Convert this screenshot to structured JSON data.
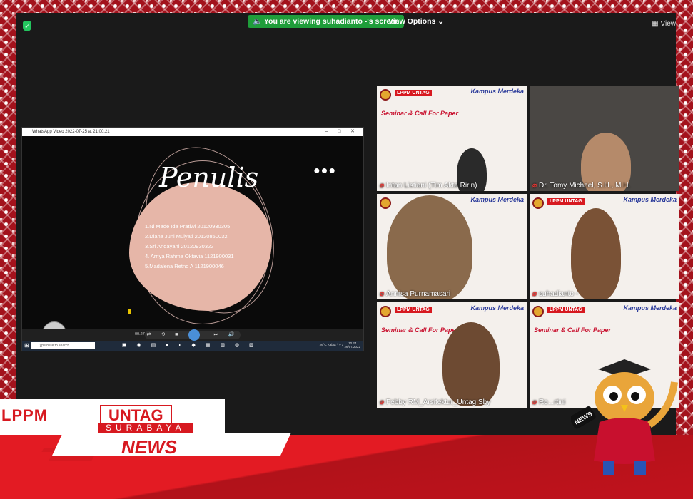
{
  "zoom": {
    "banner_text": "You are viewing suhadianto -'s screen",
    "view_options": "View Options",
    "view_button": "View"
  },
  "shared_window": {
    "title": "WhatsApp Video 2022-07-25 at 21.00.21",
    "slide_title": "Penulis",
    "authors": [
      "1.Ni Made Ida Pratiwi 20120930305",
      "2.Diana Juni Mulyati 20120850032",
      "3.Sri Andayani 20120930322",
      "4.  Arriya Rahma Oktavia 1121900031",
      "5.Madalena Retno A 1121900046"
    ],
    "player_time": "00.27",
    "progress": 0.08,
    "taskbar_search": "Type here to search",
    "tray_weather": "26°C  Kabut",
    "clock_time": "10.24",
    "clock_date": "26/07/2022"
  },
  "participants": [
    {
      "name": "Intan Listiani (Tim Akta Ririn)"
    },
    {
      "name": "Dr. Tomy Michael, S.H., M.H."
    },
    {
      "name": "Annisa Purnamasari"
    },
    {
      "name": "suhadianto -"
    },
    {
      "name": "Febby RM_Arsitektur_Untag Sby"
    },
    {
      "name": "Re...rtini"
    }
  ],
  "tile_branding": {
    "lppm": "LPPM UNTAG",
    "kampus_merdeka": "Kampus Merdeka",
    "seminar": "Seminar & Call For Paper"
  },
  "footer": {
    "lppm": "LPPM",
    "untag": "UNTAG",
    "city": "SURABAYA",
    "news": "NEWS",
    "mic_label": "NEWS"
  },
  "colors": {
    "brand_red": "#d71920",
    "zoom_green": "#1f9d3a"
  }
}
